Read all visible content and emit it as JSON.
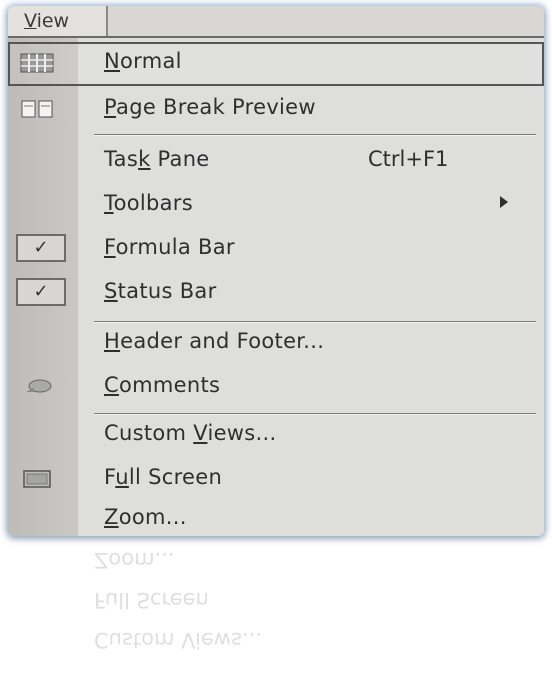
{
  "menubar": {
    "tab_label_u": "V",
    "tab_label_rest": "iew"
  },
  "menu": {
    "items": [
      {
        "id": "normal",
        "u": "N",
        "rest": "ormal",
        "pre": "",
        "shortcut": "",
        "icon": "normal-view-icon",
        "selected": true
      },
      {
        "id": "page-break-preview",
        "pre": "",
        "u": "P",
        "rest": "age Break Preview",
        "shortcut": "",
        "icon": "page-break-icon"
      },
      {
        "id": "task-pane",
        "pre": "Tas",
        "u": "k",
        "rest": " Pane",
        "shortcut": "Ctrl+F1"
      },
      {
        "id": "toolbars",
        "pre": "",
        "u": "T",
        "rest": "oolbars",
        "shortcut": "",
        "submenu": true
      },
      {
        "id": "formula-bar",
        "pre": "",
        "u": "F",
        "rest": "ormula Bar",
        "shortcut": "",
        "checked": true
      },
      {
        "id": "status-bar",
        "pre": "",
        "u": "S",
        "rest": "tatus Bar",
        "shortcut": "",
        "checked": true
      },
      {
        "id": "header-and-footer",
        "pre": "",
        "u": "H",
        "rest": "eader and Footer...",
        "shortcut": ""
      },
      {
        "id": "comments",
        "pre": "",
        "u": "C",
        "rest": "omments",
        "shortcut": "",
        "icon": "comments-icon"
      },
      {
        "id": "custom-views",
        "pre": "Custom ",
        "u": "V",
        "rest": "iews...",
        "shortcut": ""
      },
      {
        "id": "full-screen",
        "pre": "F",
        "u": "u",
        "rest": "ll Screen",
        "shortcut": "",
        "icon": "full-screen-icon"
      },
      {
        "id": "zoom",
        "pre": "",
        "u": "Z",
        "rest": "oom...",
        "shortcut": ""
      }
    ],
    "check_glyph": "✓",
    "reflection_lines": [
      "Zoom...",
      "Full Screen",
      "Custom Views..."
    ]
  }
}
